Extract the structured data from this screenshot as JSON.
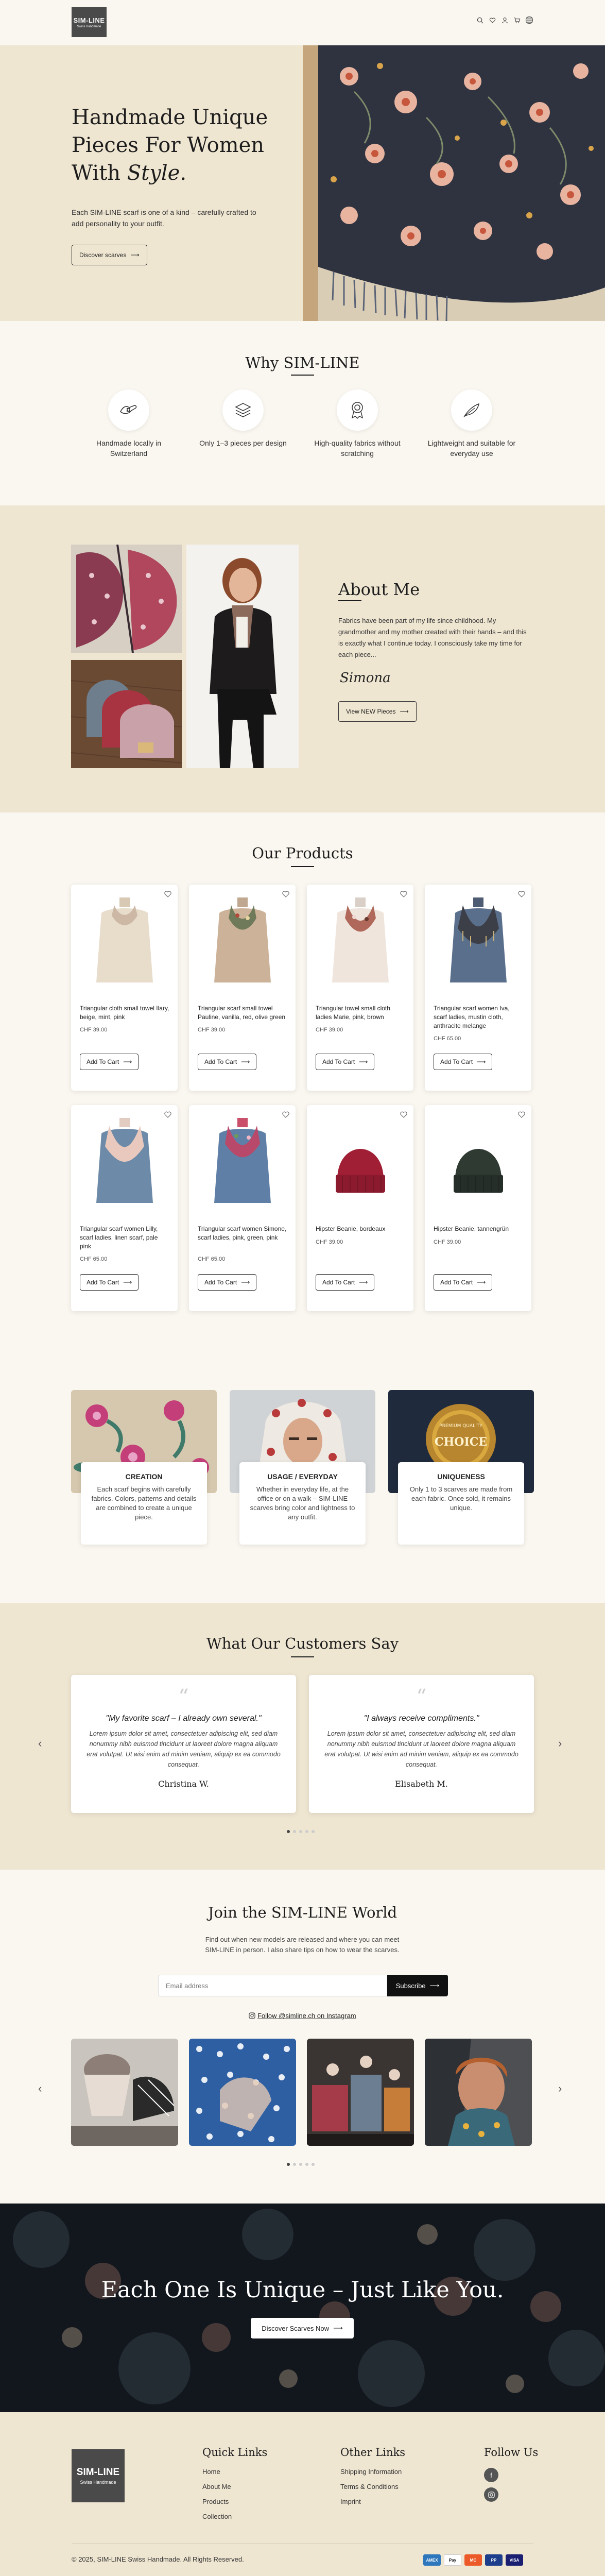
{
  "brand": {
    "logo_line1": "SIM-LINE",
    "logo_line2": "Swiss Handmade"
  },
  "header": {
    "icons": [
      "search-icon",
      "heart-icon",
      "user-icon",
      "cart-icon",
      "menu-icon"
    ]
  },
  "hero": {
    "title_line1": "Handmade Unique",
    "title_line2": "Pieces For Women",
    "title_line3_prefix": "With ",
    "title_line3_em": "Style",
    "title_line3_suffix": ".",
    "text": "Each SIM-LINE scarf is one of a kind – carefully crafted to add personality to your outfit.",
    "button": "Discover scarves"
  },
  "why": {
    "title": "Why SIM-LINE",
    "features": [
      {
        "icon": "swiss-hands-icon",
        "text": "Handmade locally in Switzerland"
      },
      {
        "icon": "layers-icon",
        "text": "Only 1–3 pieces per design"
      },
      {
        "icon": "award-icon",
        "text": "High-quality fabrics without scratching"
      },
      {
        "icon": "feather-icon",
        "text": "Lightweight and suitable for everyday use"
      }
    ]
  },
  "about": {
    "title": "About Me",
    "text": "Fabrics have been part of my life since childhood. My grandmother and my mother created with their hands – and this is exactly what I continue today. I consciously take my time for each piece...",
    "signature": "Simona",
    "button": "View NEW Pieces"
  },
  "products": {
    "title": "Our Products",
    "add_label": "Add To Cart",
    "items": [
      {
        "name": "Triangular cloth small towel Ilary, beige, mint, pink",
        "price": "CHF 39.00"
      },
      {
        "name": "Triangular scarf small towel Pauline, vanilla, red, olive green",
        "price": "CHF 39.00"
      },
      {
        "name": "Triangular towel small cloth ladies Marie, pink, brown",
        "price": "CHF 39.00"
      },
      {
        "name": "Triangular scarf women Iva, scarf ladies, mustin cloth, anthracite melange",
        "price": "CHF 65.00"
      },
      {
        "name": "Triangular scarf women Lilly, scarf ladies, linen scarf, pale pink",
        "price": "CHF 65.00"
      },
      {
        "name": "Triangular scarf women Simone, scarf ladies, pink, green, pink",
        "price": "CHF 65.00"
      },
      {
        "name": "Hipster Beanie, bordeaux",
        "price": "CHF 39.00"
      },
      {
        "name": "Hipster Beanie, tannengrün",
        "price": "CHF 39.00"
      }
    ]
  },
  "values": [
    {
      "title": "CREATION",
      "text": "Each scarf begins with carefully fabrics. Colors, patterns and details are combined to create a unique piece."
    },
    {
      "title": "USAGE / EVERYDAY",
      "text": "Whether in everyday life, at the office or on a walk – SIM-LINE scarves bring color and lightness to any outfit."
    },
    {
      "title": "UNIQUENESS",
      "text": "Only 1 to 3 scarves are made from each fabric. Once sold, it remains unique."
    }
  ],
  "values_badge": {
    "line1": "PREMIUM QUALITY",
    "line2": "CHOICE"
  },
  "testimonials": {
    "title": "What Our Customers Say",
    "items": [
      {
        "quote": "\"My favorite scarf – I already own several.\"",
        "body": "Lorem ipsum dolor sit amet, consectetuer adipiscing elit, sed diam nonummy nibh euismod tincidunt ut laoreet dolore magna aliquam erat volutpat. Ut wisi enim ad minim veniam, aliquip ex ea commodo consequat.",
        "author": "Christina W."
      },
      {
        "quote": "\"I always receive compliments.\"",
        "body": "Lorem ipsum dolor sit amet, consectetuer adipiscing elit, sed diam nonummy nibh euismod tincidunt ut laoreet dolore magna aliquam erat volutpat. Ut wisi enim ad minim veniam, aliquip ex ea commodo consequat.",
        "author": "Elisabeth M."
      }
    ]
  },
  "community": {
    "title": "Join the SIM-LINE World",
    "text": "Find out when new models are released and where you can meet SIM-LINE in person. I also share tips on how to wear the scarves.",
    "email_placeholder": "Email address",
    "subscribe": "Subscribe",
    "instagram": "Follow @simline.ch on Instagram"
  },
  "banner": {
    "title": "Each One Is Unique – Just Like You.",
    "button": "Discover Scarves Now"
  },
  "footer": {
    "quick_title": "Quick Links",
    "quick_links": [
      "Home",
      "About Me",
      "Products",
      "Collection"
    ],
    "other_title": "Other Links",
    "other_links": [
      "Shipping Information",
      "Terms & Conditions",
      "Imprint"
    ],
    "follow_title": "Follow Us",
    "copyright": "© 2025, SIM-LINE Swiss Handmade. All Rights Reserved.",
    "payments": [
      "American Express",
      "Apple Pay",
      "Mastercard",
      "PayPal",
      "Visa"
    ],
    "payment_labels": [
      "AMEX",
      "Pay",
      "MC",
      "PP",
      "VISA"
    ]
  }
}
